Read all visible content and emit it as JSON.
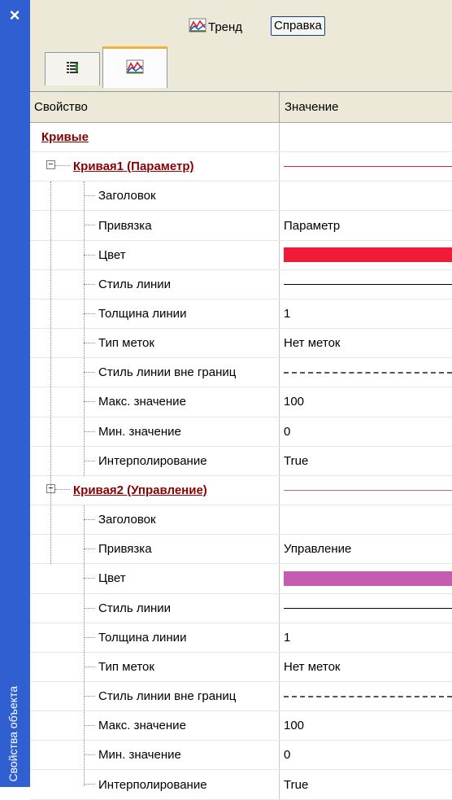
{
  "window": {
    "side_title": "Свойства объекта",
    "close_label": "×"
  },
  "toolbar": {
    "trend_label": "Тренд",
    "help_label": "Справка"
  },
  "tabs": [
    {
      "icon": "property-list-icon"
    },
    {
      "icon": "trend-icon"
    }
  ],
  "grid": {
    "col_property": "Свойство",
    "col_value": "Значение",
    "group_label": "Кривые",
    "curves": [
      {
        "label": "Кривая1 (Параметр)",
        "line_color": "#e0233a",
        "props": [
          {
            "name": "Заголовок",
            "value": ""
          },
          {
            "name": "Привязка",
            "value": "Параметр"
          },
          {
            "name": "Цвет",
            "color": "#ee1b39"
          },
          {
            "name": "Стиль линии",
            "line": "solid"
          },
          {
            "name": "Толщина линии",
            "value": "1"
          },
          {
            "name": "Тип меток",
            "value": "Нет меток"
          },
          {
            "name": "Стиль линии вне границ",
            "line": "dashed"
          },
          {
            "name": "Макс. значение",
            "value": "100"
          },
          {
            "name": "Мин. значение",
            "value": "0"
          },
          {
            "name": "Интерполирование",
            "value": "True"
          }
        ]
      },
      {
        "label": "Кривая2 (Управление)",
        "line_color": "#c060b0",
        "props": [
          {
            "name": "Заголовок",
            "value": ""
          },
          {
            "name": "Привязка",
            "value": "Управление"
          },
          {
            "name": "Цвет",
            "color": "#c45cb1"
          },
          {
            "name": "Стиль линии",
            "line": "solid"
          },
          {
            "name": "Толщина линии",
            "value": "1"
          },
          {
            "name": "Тип меток",
            "value": "Нет меток"
          },
          {
            "name": "Стиль линии вне границ",
            "line": "dashed"
          },
          {
            "name": "Макс. значение",
            "value": "100"
          },
          {
            "name": "Мин. значение",
            "value": "0"
          },
          {
            "name": "Интерполирование",
            "value": "True"
          }
        ]
      }
    ]
  }
}
